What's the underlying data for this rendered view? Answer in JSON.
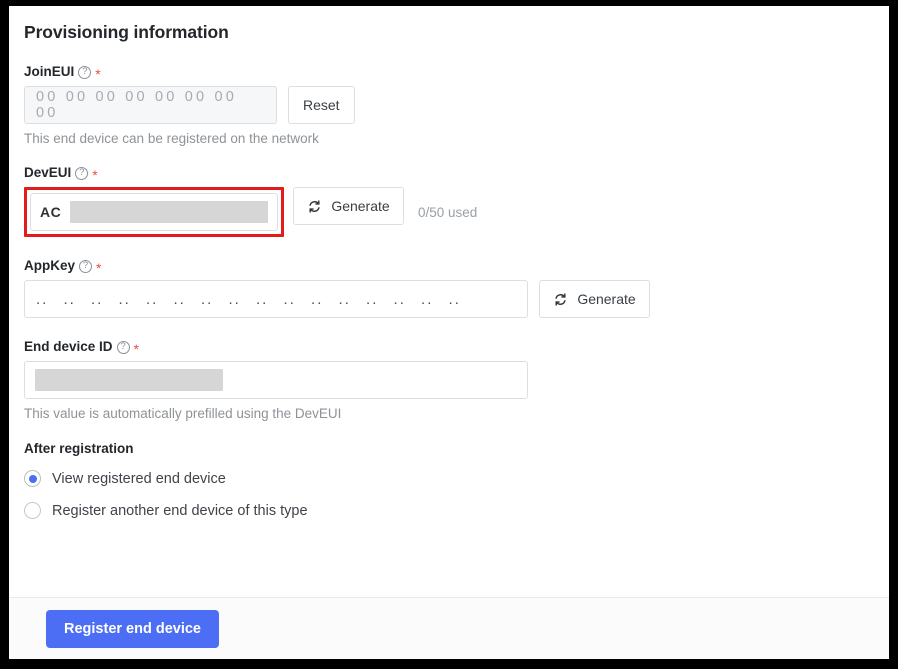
{
  "section": {
    "title": "Provisioning information"
  },
  "fields": {
    "join_eui": {
      "label": "JoinEUI",
      "help_icon": "help-circle-icon",
      "required_marker": "*",
      "value": "00 00 00 00 00 00 00 00",
      "reset_label": "Reset",
      "hint": "This end device can be registered on the network"
    },
    "dev_eui": {
      "label": "DevEUI",
      "help_icon": "help-circle-icon",
      "required_marker": "*",
      "value_prefix": "AC",
      "value_redacted": "",
      "generate_label": "Generate",
      "generate_icon": "refresh-icon",
      "usage": "0/50 used"
    },
    "app_key": {
      "label": "AppKey",
      "help_icon": "help-circle-icon",
      "required_marker": "*",
      "value": ".. .. .. .. .. .. .. .. .. .. .. .. .. .. .. ..",
      "generate_label": "Generate",
      "generate_icon": "refresh-icon"
    },
    "end_device_id": {
      "label": "End device ID",
      "help_icon": "help-circle-icon",
      "required_marker": "*",
      "value_redacted": "",
      "hint": "This value is automatically prefilled using the DevEUI"
    }
  },
  "after_registration": {
    "title": "After registration",
    "options": [
      {
        "label": "View registered end device",
        "selected": true
      },
      {
        "label": "Register another end device of this type",
        "selected": false
      }
    ]
  },
  "footer": {
    "submit_label": "Register end device"
  },
  "colors": {
    "primary": "#4b6ef5",
    "required": "#e8503a",
    "highlight_box": "#e21b1b",
    "redact": "#d6d6d6",
    "border": "#dcdee0"
  }
}
